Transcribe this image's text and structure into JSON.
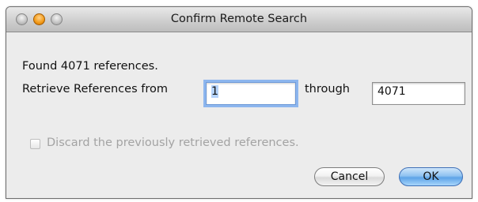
{
  "window": {
    "title": "Confirm Remote Search"
  },
  "dialog": {
    "found_message": "Found 4071 references.",
    "retrieve_label": "Retrieve References from",
    "from_value": "1",
    "through_label": "through",
    "through_value": "4071",
    "discard_label": "Discard the previously retrieved references.",
    "discard_checked": false,
    "discard_enabled": false
  },
  "buttons": {
    "cancel_label": "Cancel",
    "ok_label": "OK"
  },
  "colors": {
    "window_bg": "#ececec",
    "focus_ring": "#8db6ee",
    "default_button": "#5da3e7",
    "minimize_button": "#f29a17"
  }
}
